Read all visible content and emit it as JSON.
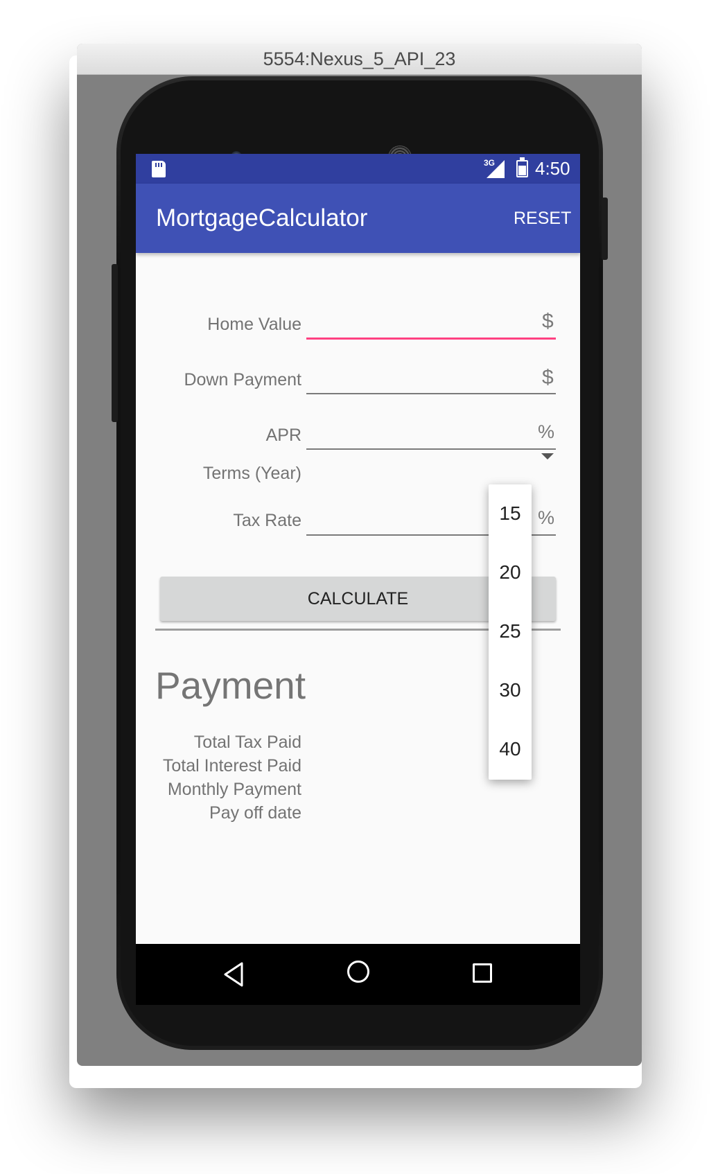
{
  "window": {
    "title": "5554:Nexus_5_API_23"
  },
  "statusbar": {
    "network": "3G",
    "time": "4:50"
  },
  "appbar": {
    "title": "MortgageCalculator",
    "reset_label": "RESET"
  },
  "form": {
    "home_value": {
      "label": "Home Value",
      "suffix": "$",
      "value": ""
    },
    "down_payment": {
      "label": "Down Payment",
      "suffix": "$",
      "value": ""
    },
    "apr": {
      "label": "APR",
      "suffix": "%",
      "value": ""
    },
    "terms": {
      "label": "Terms (Year)"
    },
    "tax_rate": {
      "label": "Tax Rate",
      "suffix": "%",
      "value": ""
    },
    "calculate_label": "CALCULATE"
  },
  "results": {
    "title": "Payment",
    "total_tax_paid": "Total Tax Paid",
    "total_interest_paid": "Total Interest Paid",
    "monthly_payment": "Monthly Payment",
    "pay_off_date": "Pay off date"
  },
  "terms_dropdown": {
    "options": [
      "15",
      "20",
      "25",
      "30",
      "40"
    ]
  },
  "colors": {
    "primary": "#3f51b5",
    "primary_dark": "#303f9f",
    "accent": "#ff4081"
  }
}
